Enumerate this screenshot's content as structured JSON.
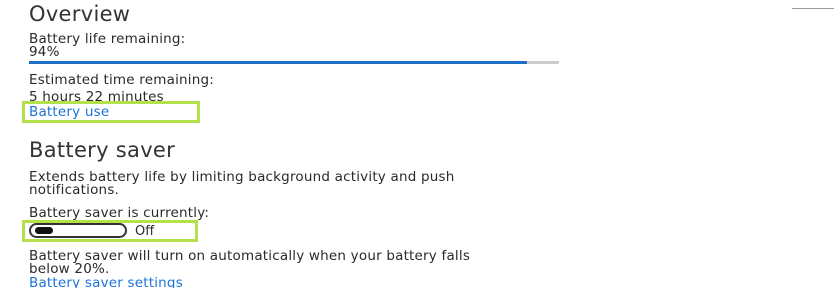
{
  "overview": {
    "heading": "Overview",
    "battery_life_label": "Battery life remaining:",
    "battery_life_value": "94%",
    "battery_life_percent": 94,
    "estimated_label": "Estimated time remaining:",
    "estimated_value": "5 hours 22 minutes",
    "battery_use_link": "Battery use"
  },
  "battery_saver": {
    "heading": "Battery saver",
    "description_line1": "Extends battery life by limiting background activity and push",
    "description_line2": "notifications.",
    "status_label": "Battery saver is currently:",
    "toggle_state": "Off",
    "auto_line1": "Battery saver will turn on automatically when your battery falls",
    "auto_line2": "below 20%.",
    "settings_link": "Battery saver settings"
  },
  "colors": {
    "accent": "#1e6fc6",
    "link": "#1a73d8",
    "highlight": "#b6e04a"
  }
}
